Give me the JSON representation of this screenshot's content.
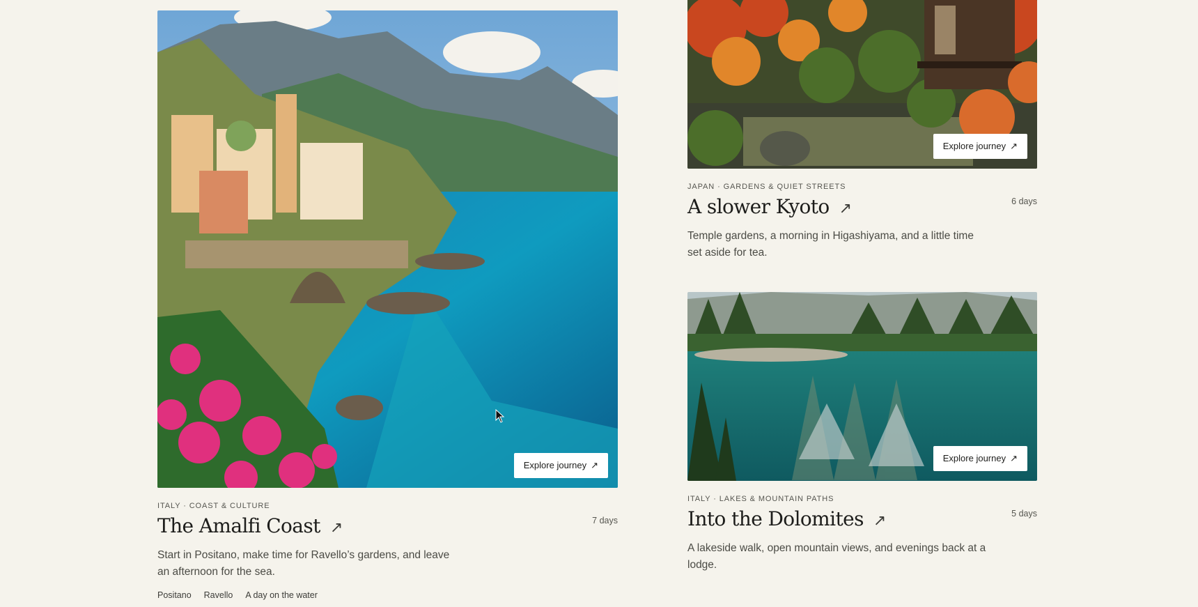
{
  "cards": [
    {
      "id": "amalfi",
      "eyebrow": "ITALY · COAST & CULTURE",
      "title": "The Amalfi Coast",
      "duration": "7 days",
      "description": "Start in Positano, make time for Ravello’s gardens, and leave an afternoon for the sea.",
      "tags": [
        "Positano",
        "Ravello",
        "A day on the water"
      ],
      "cta": "Explore journey",
      "cta_icon": "arrow-up-right-icon",
      "title_icon": "arrow-up-right-icon"
    },
    {
      "id": "kyoto",
      "eyebrow": "JAPAN · GARDENS & QUIET STREETS",
      "title": "A slower Kyoto",
      "duration": "6 days",
      "description": "Temple gardens, a morning in Higashiyama, and a little time set aside for tea.",
      "cta": "Explore journey",
      "cta_icon": "arrow-up-right-icon",
      "title_icon": "arrow-up-right-icon"
    },
    {
      "id": "dolomites",
      "eyebrow": "ITALY · LAKES & MOUNTAIN PATHS",
      "title": "Into the Dolomites",
      "duration": "5 days",
      "description": "A lakeside walk, open mountain views, and evenings back at a lodge.",
      "cta": "Explore journey",
      "cta_icon": "arrow-up-right-icon",
      "title_icon": "arrow-up-right-icon"
    }
  ],
  "arrow_glyph": "↗"
}
